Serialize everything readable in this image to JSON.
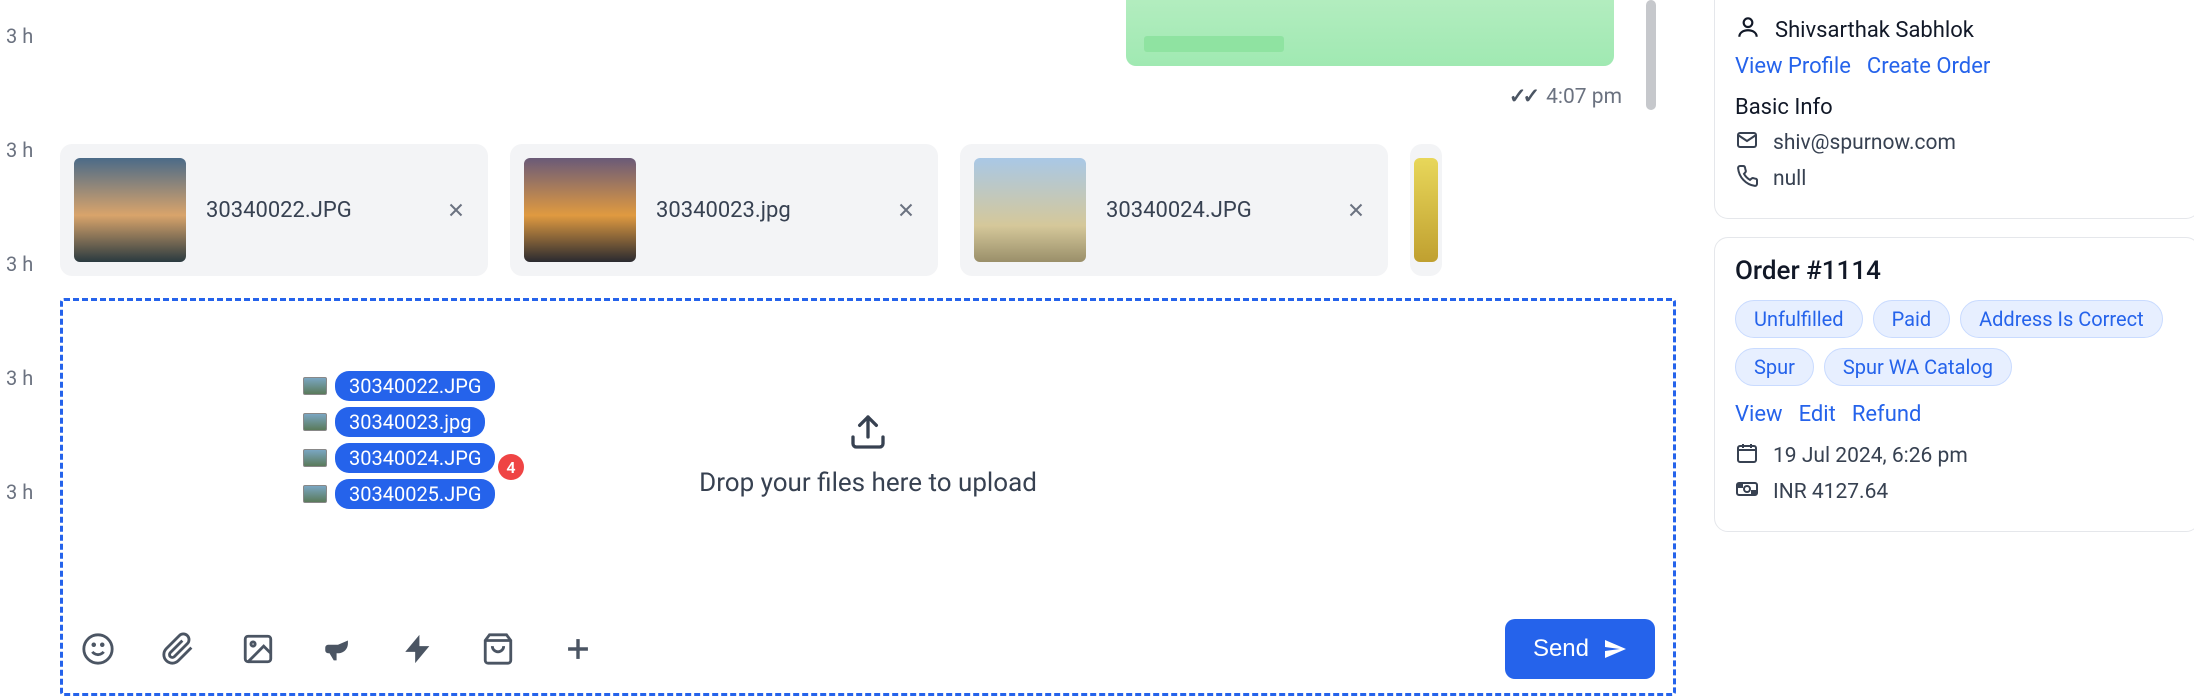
{
  "timeline": {
    "labels": [
      "3 h",
      "3 h",
      "3 h",
      "3 h",
      "3 h"
    ]
  },
  "message": {
    "time": "4:07 pm"
  },
  "attachments": [
    {
      "name": "30340022.JPG"
    },
    {
      "name": "30340023.jpg"
    },
    {
      "name": "30340024.JPG"
    }
  ],
  "dropzone": {
    "text": "Drop your files here to upload",
    "count": "4",
    "files": [
      {
        "name": "30340022.JPG"
      },
      {
        "name": "30340023.jpg"
      },
      {
        "name": "30340024.JPG"
      },
      {
        "name": "30340025.JPG"
      }
    ]
  },
  "composer": {
    "send_label": "Send"
  },
  "profile": {
    "name": "Shivsarthak Sabhlok",
    "view_profile": "View Profile",
    "create_order": "Create Order",
    "basic_info": "Basic Info",
    "email": "shiv@spurnow.com",
    "phone": "null"
  },
  "order": {
    "title": "Order #1114",
    "tags": [
      "Unfulfilled",
      "Paid",
      "Address Is Correct",
      "Spur",
      "Spur WA Catalog"
    ],
    "view": "View",
    "edit": "Edit",
    "refund": "Refund",
    "date": "19 Jul 2024, 6:26 pm",
    "total": "INR 4127.64"
  }
}
